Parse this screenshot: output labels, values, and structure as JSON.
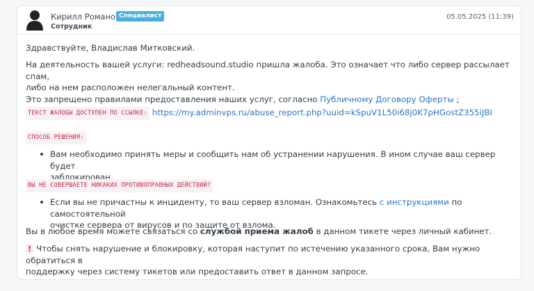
{
  "author": {
    "name": "Кирилл Романов",
    "badge": "Специалист",
    "role": "Сотрудник",
    "date": "05.05.2025 (11:39)"
  },
  "message": {
    "greeting": "Здравствуйте, Владислав Митковский.",
    "para1_line1": "На деятельность вашей услуги: redheadsound.studio пришла жалоба. Это означает что либо сервер рассылает спам,",
    "para1_line2": "либо на нем расположен нелегальный контент.",
    "para1_line3_prefix": "Это запрещено правилами предоставления наших услуг, согласно",
    "offer_link": "Публичному Договору Оферты",
    "para1_line3_suffix": ";",
    "report_label": "ТЕКСТ ЖАЛОБЫ ДОСТУПЕН ПО ССЫЛКЕ:",
    "report_link": "https://my.adminvps.ru/abuse_report.php?uuid=kSpuV1L50i68j0K7pHGostZ355iJBI",
    "solution_label": "СПОСОБ РЕШЕНИЯ:",
    "bullet1_line1": "Вам необходимо принять меры и сообщить нам об устранении нарушения. В ином случае ваш сервер будет",
    "bullet1_line2": "заблокирован.",
    "innocent_label": "ВЫ НЕ СОВЕРШАЕТЕ НИКАКИХ ПРОТИВОПРАВНЫХ ДЕЙСТВИЙ?",
    "bullet2_prefix": "Если вы не причастны к инциденту, то ваш сервер взломан. Ознакомьтесь",
    "bullet2_link": "с инструкциями",
    "bullet2_suffix": "по самостоятельной",
    "bullet2_line2": "очистке сервера от вирусов и по защите от взлома.",
    "contact_prefix": "Вы в любое время можете связаться со",
    "contact_bold": "службой приема жалоб",
    "contact_suffix": "в данном тикете через личный кабинет.",
    "warning_mark": "!",
    "warning_line1": "Чтобы снять нарушение и блокировку, которая наступит по истечению указанного срока, Вам нужно обратиться в",
    "warning_line2": "поддержку через систему тикетов или предоставить ответ в данном запросе."
  },
  "colors": {
    "link": "#2d74c4",
    "badge_bg": "#4ab0d9",
    "label_text": "#c02e4a",
    "label_bg": "#f9f2f4"
  },
  "icons": {
    "avatar": "user-silhouette-icon"
  }
}
